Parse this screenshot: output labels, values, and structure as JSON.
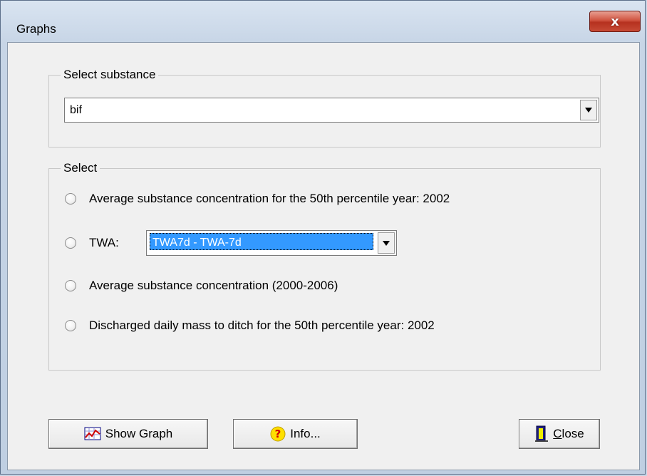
{
  "window": {
    "title": "Graphs",
    "close_glyph": "x"
  },
  "substance_group": {
    "label": "Select substance",
    "selected": "bif"
  },
  "select_group": {
    "label": "Select",
    "options": [
      {
        "label": "Average substance concentration for the 50th percentile year: 2002",
        "checked": false
      },
      {
        "label": "TWA:",
        "checked": false
      },
      {
        "label": "Average substance concentration (2000-2006)",
        "checked": false
      },
      {
        "label": "Discharged daily mass to ditch for the 50th percentile year: 2002",
        "checked": false
      }
    ],
    "twa_selected": "TWA7d - TWA-7d"
  },
  "buttons": {
    "show_graph": "Show Graph",
    "info": "Info...",
    "close_prefix": "C",
    "close_rest": "lose"
  },
  "icons": {
    "show_graph": "chart-icon",
    "info": "question-icon",
    "close": "door-exit-icon"
  },
  "colors": {
    "selection": "#3399ff",
    "close_button": "#c64a35"
  }
}
